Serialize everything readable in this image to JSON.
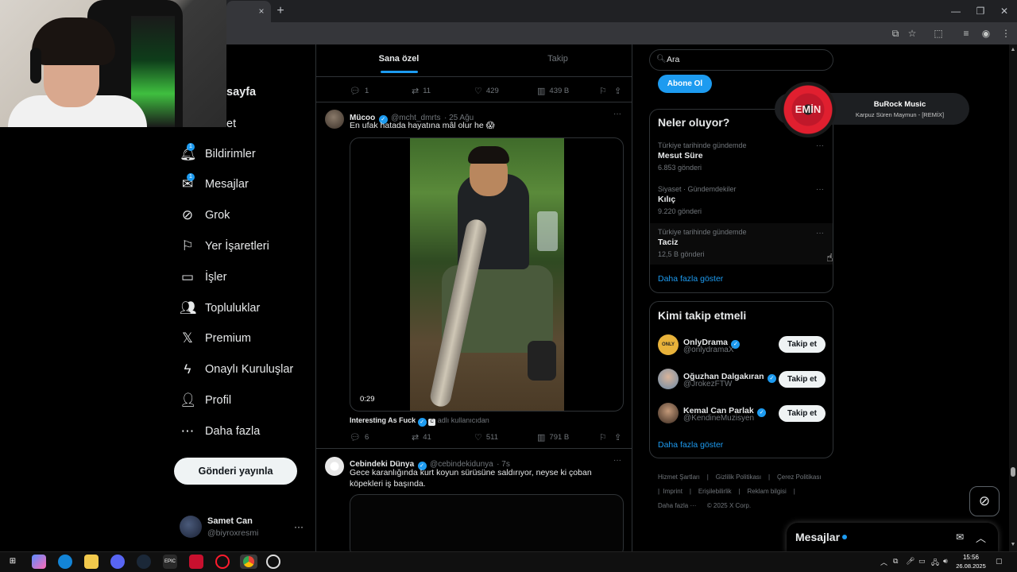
{
  "browser": {
    "tab_close": "×",
    "new_tab": "+",
    "minimize": "—",
    "restore": "❐",
    "close": "✕",
    "icons": [
      "cast-icon",
      "star-icon",
      "extensions-icon",
      "media-icon",
      "profile-icon",
      "menu-icon"
    ]
  },
  "nav": {
    "home_partial": "sayfa",
    "explore_partial": "et",
    "items": [
      {
        "label": "Bildirimler",
        "icon": "bell-icon",
        "badge": "1"
      },
      {
        "label": "Mesajlar",
        "icon": "mail-icon",
        "badge": "1"
      },
      {
        "label": "Grok",
        "icon": "grok-icon"
      },
      {
        "label": "Yer İşaretleri",
        "icon": "bookmark-icon"
      },
      {
        "label": "İşler",
        "icon": "briefcase-icon"
      },
      {
        "label": "Topluluklar",
        "icon": "communities-icon"
      },
      {
        "label": "Premium",
        "icon": "x-logo-icon"
      },
      {
        "label": "Onaylı Kuruluşlar",
        "icon": "lightning-icon"
      },
      {
        "label": "Profil",
        "icon": "person-icon"
      },
      {
        "label": "Daha fazla",
        "icon": "more-circle-icon"
      }
    ],
    "post_button": "Gönderi yayınla",
    "account": {
      "name": "Samet Can",
      "handle": "@biyroxresmi",
      "more": "···"
    }
  },
  "feed": {
    "tabs": [
      {
        "label": "Sana özel",
        "active": true
      },
      {
        "label": "Takip",
        "active": false
      }
    ],
    "top_actions": {
      "replies": "1",
      "reposts": "11",
      "likes": "429",
      "views": "439 B"
    },
    "tweets": [
      {
        "name": "Mücoo",
        "handle": "@mcht_dmrts",
        "time": "· 25 Ağu",
        "more": "···",
        "text": "En ufak hatada hayatına mâl olur he 😱",
        "video_time": "0:29",
        "source": "Interesting As Fuck",
        "source_suffix": "adlı kullanıcıdan",
        "actions": {
          "replies": "6",
          "reposts": "41",
          "likes": "511",
          "views": "791 B"
        }
      },
      {
        "name": "Cebindeki Dünya",
        "handle": "@cebindekidunya",
        "time": "· 7s",
        "more": "···",
        "text": "Gece karanlığında kurt koyun sürüsüne saldırıyor, neyse ki çoban köpekleri iş başında."
      }
    ]
  },
  "sidebar": {
    "search_placeholder": "Ara",
    "subscribe": "Abone Ol",
    "trends": {
      "title": "Neler oluyor?",
      "items": [
        {
          "context": "Türkiye tarihinde gündemde",
          "name": "Mesut Süre",
          "count": "6.853 gönderi"
        },
        {
          "context": "Siyaset · Gündemdekiler",
          "name": "Kılıç",
          "count": "9.220 gönderi"
        },
        {
          "context": "Türkiye tarihinde gündemde",
          "name": "Taciz",
          "count": "12,5 B gönderi"
        }
      ],
      "more": "···",
      "show_more": "Daha fazla göster"
    },
    "who_to_follow": {
      "title": "Kimi takip etmeli",
      "items": [
        {
          "name": "OnlyDrama",
          "handle": "@onlydramaX",
          "button": "Takip et"
        },
        {
          "name": "Oğuzhan Dalgakıran",
          "handle": "@JrokezFTW",
          "button": "Takip et"
        },
        {
          "name": "Kemal Can Parlak",
          "handle": "@KendineMuzisyen",
          "button": "Takip et"
        }
      ],
      "show_more": "Daha fazla göster"
    },
    "footer": [
      "Hizmet Şartları",
      "|",
      "Gizlilik Politikası",
      "|",
      "Çerez Politikası",
      "|",
      "Imprint",
      "|",
      "Erişilebilirlik",
      "|",
      "Reklam bilgisi",
      "|",
      "Daha fazla ···",
      "© 2025 X Corp."
    ]
  },
  "music": {
    "title": "BuRock Music",
    "artist": "Karpuz Süren Maymun - [REMİX]",
    "disc_text": "EMİN"
  },
  "messages": {
    "title": "Mesajlar"
  },
  "taskbar": {
    "time": "15:56",
    "date": "26.08.2025"
  },
  "colors": {
    "accent": "#1d9bf0",
    "bg": "#000000",
    "border": "#2f3336",
    "muted": "#71767b"
  }
}
